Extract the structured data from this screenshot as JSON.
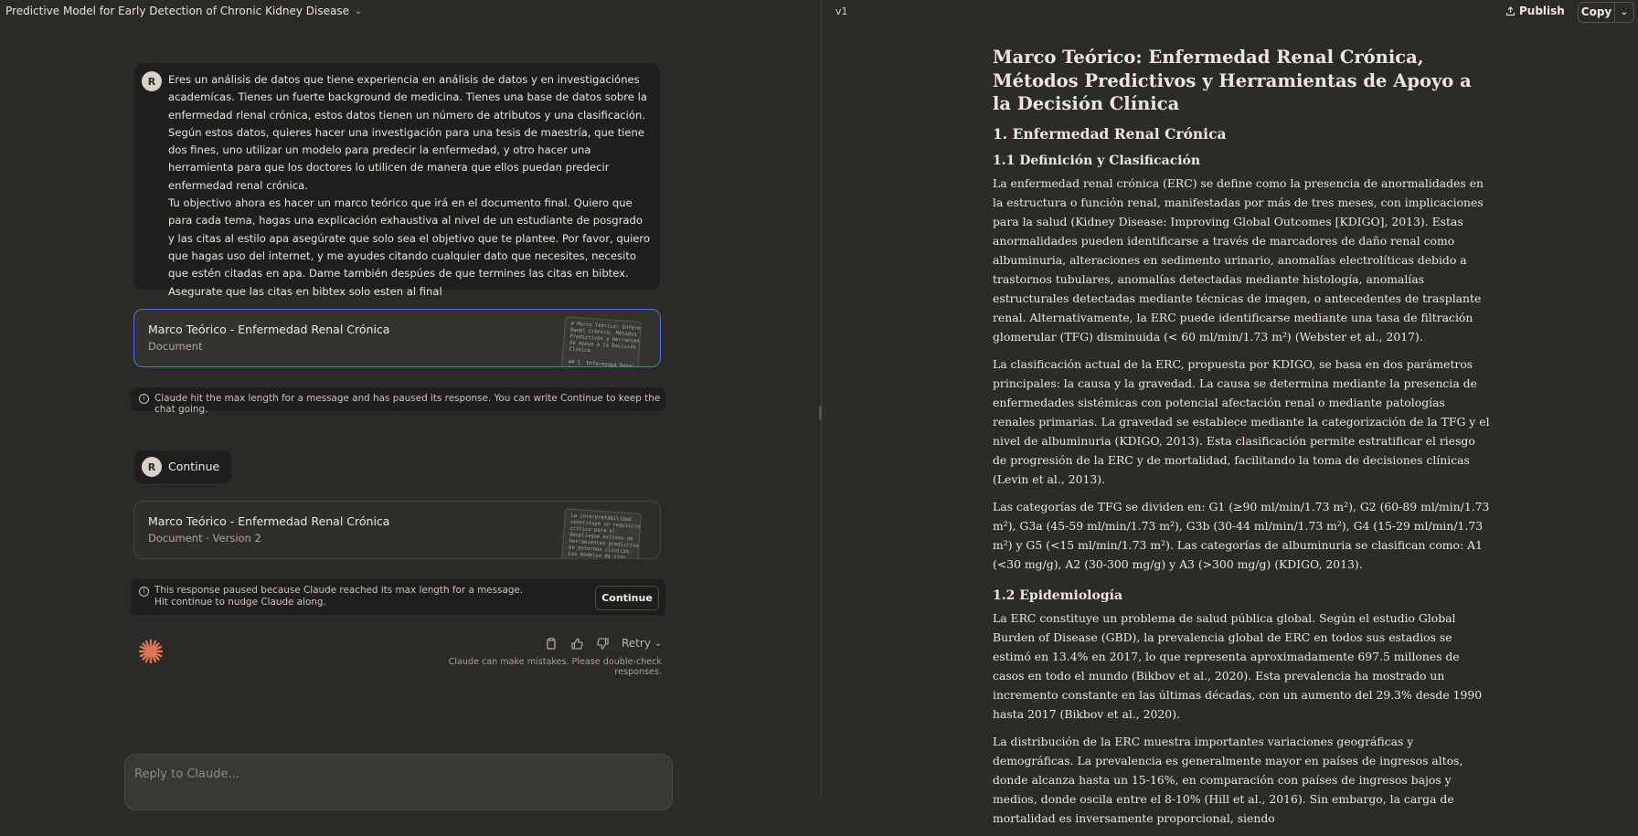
{
  "header": {
    "title": "Predictive Model for Early Detection of Chronic Kidney Disease",
    "version": "v1",
    "publish_label": "Publish",
    "copy_label": "Copy"
  },
  "user_message": {
    "avatar": "R",
    "paragraphs": [
      "Eres un análisis de datos que tiene experiencia en análisis de datos y en investigaciónes academícas. Tienes un fuerte background de medicina. Tienes una base de datos sobre la enfermedad rlenal crónica, estos datos tienen un número de atributos y una clasificación. Según estos datos, quieres hacer una investigación para una tesis de maestría, que tiene dos fines, uno utilizar un modelo para predecir la enfermedad, y otro hacer una herramienta para que los doctores lo utilicen de manera que ellos puedan predecir enfermedad renal crónica.",
      "Tu objectivo ahora es hacer un marco teórico que irá en el documento final. Quiero que para cada tema, hagas una explicación exhaustiva al nivel de un estudiante de posgrado y las citas al estilo apa asegúrate que solo sea el objetivo que te plantee. Por favor, quiero que hagas uso del internet, y me ayudes citando cualquier dato que necesites, necesito que estén citadas en apa. Dame también despúes de que termines las citas en bibtex. Asegurate que las citas en bibtex solo esten al final"
    ]
  },
  "artifact_card_1": {
    "title": "Marco Teórico - Enfermedad Renal Crónica",
    "subtitle": "Document",
    "thumb_text": "# Marco Teórico: Enfermedad\nRenal Crónica, Métodos\nPredictivos y Herramientas\nde Apoyo a la Decisión\nClínica\n\n## 1. Enfermedad Renal\nCrónica\n\n### 1.1 Definición"
  },
  "notice_1": "Claude hit the max length for a message and has paused its response. You can write Continue to keep the chat going.",
  "continue_message": {
    "avatar": "R",
    "text": "Continue"
  },
  "artifact_card_2": {
    "title": "Marco Teórico - Enfermedad Renal Crónica",
    "subtitle": "Document · Version 2",
    "thumb_text": "La interpretabilidad\nconstituye un requisito\ncrítico para el\ndespliegue exitoso de\nherramientas predictivas\nen entornos clínicos.\nLos modelos de tipo\n\"caja negra\" pueden"
  },
  "notice_2": {
    "text": "This response paused because Claude reached its max length for a message. Hit continue to nudge Claude along.",
    "button": "Continue"
  },
  "actions": {
    "retry_label": "Retry",
    "disclaimer": "Claude can make mistakes. Please double-check responses."
  },
  "composer": {
    "placeholder": "Reply to Claude..."
  },
  "document": {
    "title": "Marco Teórico: Enfermedad Renal Crónica, Métodos Predictivos y Herramientas de Apoyo a la Decisión Clínica",
    "section1": "1. Enfermedad Renal Crónica",
    "sub11": "1.1 Definición y Clasificación",
    "p1": "La enfermedad renal crónica (ERC) se define como la presencia de anormalidades en la estructura o función renal, manifestadas por más de tres meses, con implicaciones para la salud (Kidney Disease: Improving Global Outcomes [KDIGO], 2013). Estas anormalidades pueden identificarse a través de marcadores de daño renal como albuminuria, alteraciones en sedimento urinario, anomalías electrolíticas debido a trastornos tubulares, anomalías detectadas mediante histología, anomalías estructurales detectadas mediante técnicas de imagen, o antecedentes de trasplante renal. Alternativamente, la ERC puede identificarse mediante una tasa de filtración glomerular (TFG) disminuida (< 60 ml/min/1.73 m²) (Webster et al., 2017).",
    "p2": "La clasificación actual de la ERC, propuesta por KDIGO, se basa en dos parámetros principales: la causa y la gravedad. La causa se determina mediante la presencia de enfermedades sistémicas con potencial afectación renal o mediante patologías renales primarias. La gravedad se establece mediante la categorización de la TFG y el nivel de albuminuria (KDIGO, 2013). Esta clasificación permite estratificar el riesgo de progresión de la ERC y de mortalidad, facilitando la toma de decisiones clínicas (Levin et al., 2013).",
    "p3": "Las categorías de TFG se dividen en: G1 (≥90 ml/min/1.73 m²), G2 (60-89 ml/min/1.73 m²), G3a (45-59 ml/min/1.73 m²), G3b (30-44 ml/min/1.73 m²), G4 (15-29 ml/min/1.73 m²) y G5 (<15 ml/min/1.73 m²). Las categorías de albuminuria se clasifican como: A1 (<30 mg/g), A2 (30-300 mg/g) y A3 (>300 mg/g) (KDIGO, 2013).",
    "sub12": "1.2 Epidemiología",
    "p4": "La ERC constituye un problema de salud pública global. Según el estudio Global Burden of Disease (GBD), la prevalencia global de ERC en todos sus estadios se estimó en 13.4% en 2017, lo que representa aproximadamente 697.5 millones de casos en todo el mundo (Bikbov et al., 2020). Esta prevalencia ha mostrado un incremento constante en las últimas décadas, con un aumento del 29.3% desde 1990 hasta 2017 (Bikbov et al., 2020).",
    "p5": "La distribución de la ERC muestra importantes variaciones geográficas y demográficas. La prevalencia es generalmente mayor en países de ingresos altos, donde alcanza hasta un 15-16%, en comparación con países de ingresos bajos y medios, donde oscila entre el 8-10% (Hill et al., 2016). Sin embargo, la carga de mortalidad es inversamente proporcional, siendo"
  },
  "colors": {
    "accent_border": "#3b82c8",
    "claude_spark": "#d97757",
    "background": "#2b2a27"
  }
}
